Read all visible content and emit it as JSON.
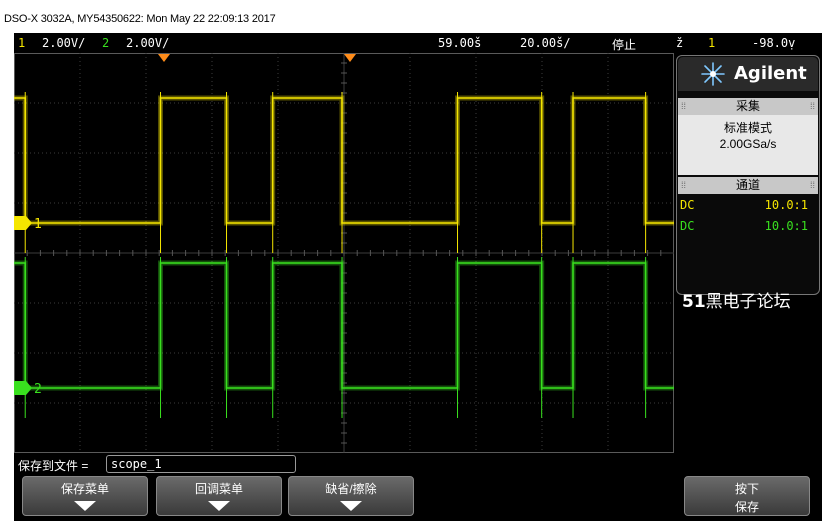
{
  "window": {
    "title": "DSO-X 3032A, MY54350622: Mon May 22 22:09:13 2017"
  },
  "status_bar": {
    "ch1_num": "1",
    "ch1_scale": "2.00V/",
    "ch2_num": "2",
    "ch2_scale": "2.00V/",
    "trigger_delay": "59.00š",
    "time_scale": "20.00š/",
    "run_state": "停止",
    "trigger_icon": "ž",
    "trigger_source": "1",
    "trigger_level": "-98.0ṿ"
  },
  "markers": {
    "ch1": "1",
    "ch2": "2"
  },
  "brand": {
    "name": "Agilent",
    "logo_icon": "agilent-spark-icon"
  },
  "acquisition": {
    "header": "采集",
    "mode": "标准模式",
    "sample_rate": "2.00GSa/s"
  },
  "channels": {
    "header": "通道",
    "rows": [
      {
        "coupling": "DC",
        "probe": "10.0:1",
        "color": "#f5e600"
      },
      {
        "coupling": "DC",
        "probe": "10.0:1",
        "color": "#39e01f"
      }
    ]
  },
  "watermark": {
    "bold": "51",
    "rest": "黑电子论坛"
  },
  "save": {
    "label": "保存到文件 =",
    "filename": "scope_1"
  },
  "softkeys": [
    {
      "label": "保存菜单"
    },
    {
      "label": "回调菜单"
    },
    {
      "label": "缺省/擦除"
    }
  ],
  "press_key": {
    "line1": "按下",
    "line2": "保存"
  },
  "colors": {
    "ch1": "#f5e600",
    "ch2": "#39e01f",
    "trigger_marker": "#ff8c1a",
    "grid": "#4a4a4a"
  },
  "chart_data": {
    "type": "line",
    "x_unit": "µs",
    "y_unit": "V",
    "x_range": [
      -40.9,
      159.1
    ],
    "series": [
      {
        "name": "1",
        "color": "#f5e600",
        "x": [
          -40.9,
          -37.5,
          -37.5,
          -38.5,
          -38.5,
          3.5,
          3.5,
          23.5,
          23.5,
          37.5,
          37.5,
          58.5,
          58.5,
          93.5,
          93.5,
          119,
          119,
          128.5,
          128.5,
          150.5,
          150.5,
          159.1
        ],
        "y": [
          5.0,
          5.0,
          0.0,
          0.0,
          0.0,
          0.0,
          5.0,
          5.0,
          0.0,
          0.0,
          5.0,
          5.0,
          0.0,
          0.0,
          5.0,
          5.0,
          0.0,
          0.0,
          5.0,
          5.0,
          0.0,
          0.0
        ]
      },
      {
        "name": "2",
        "color": "#39e01f",
        "x": [
          -40.9,
          -37.5,
          -37.5,
          3.5,
          3.5,
          23.5,
          23.5,
          37.5,
          37.5,
          58.5,
          58.5,
          93.5,
          93.5,
          119,
          119,
          128.5,
          128.5,
          150.5,
          150.5,
          159.1
        ],
        "y": [
          5.0,
          5.0,
          0.0,
          0.0,
          5.0,
          5.0,
          0.0,
          0.0,
          5.0,
          5.0,
          0.0,
          0.0,
          5.0,
          5.0,
          0.0,
          0.0,
          5.0,
          5.0,
          0.0,
          0.0
        ]
      }
    ]
  }
}
